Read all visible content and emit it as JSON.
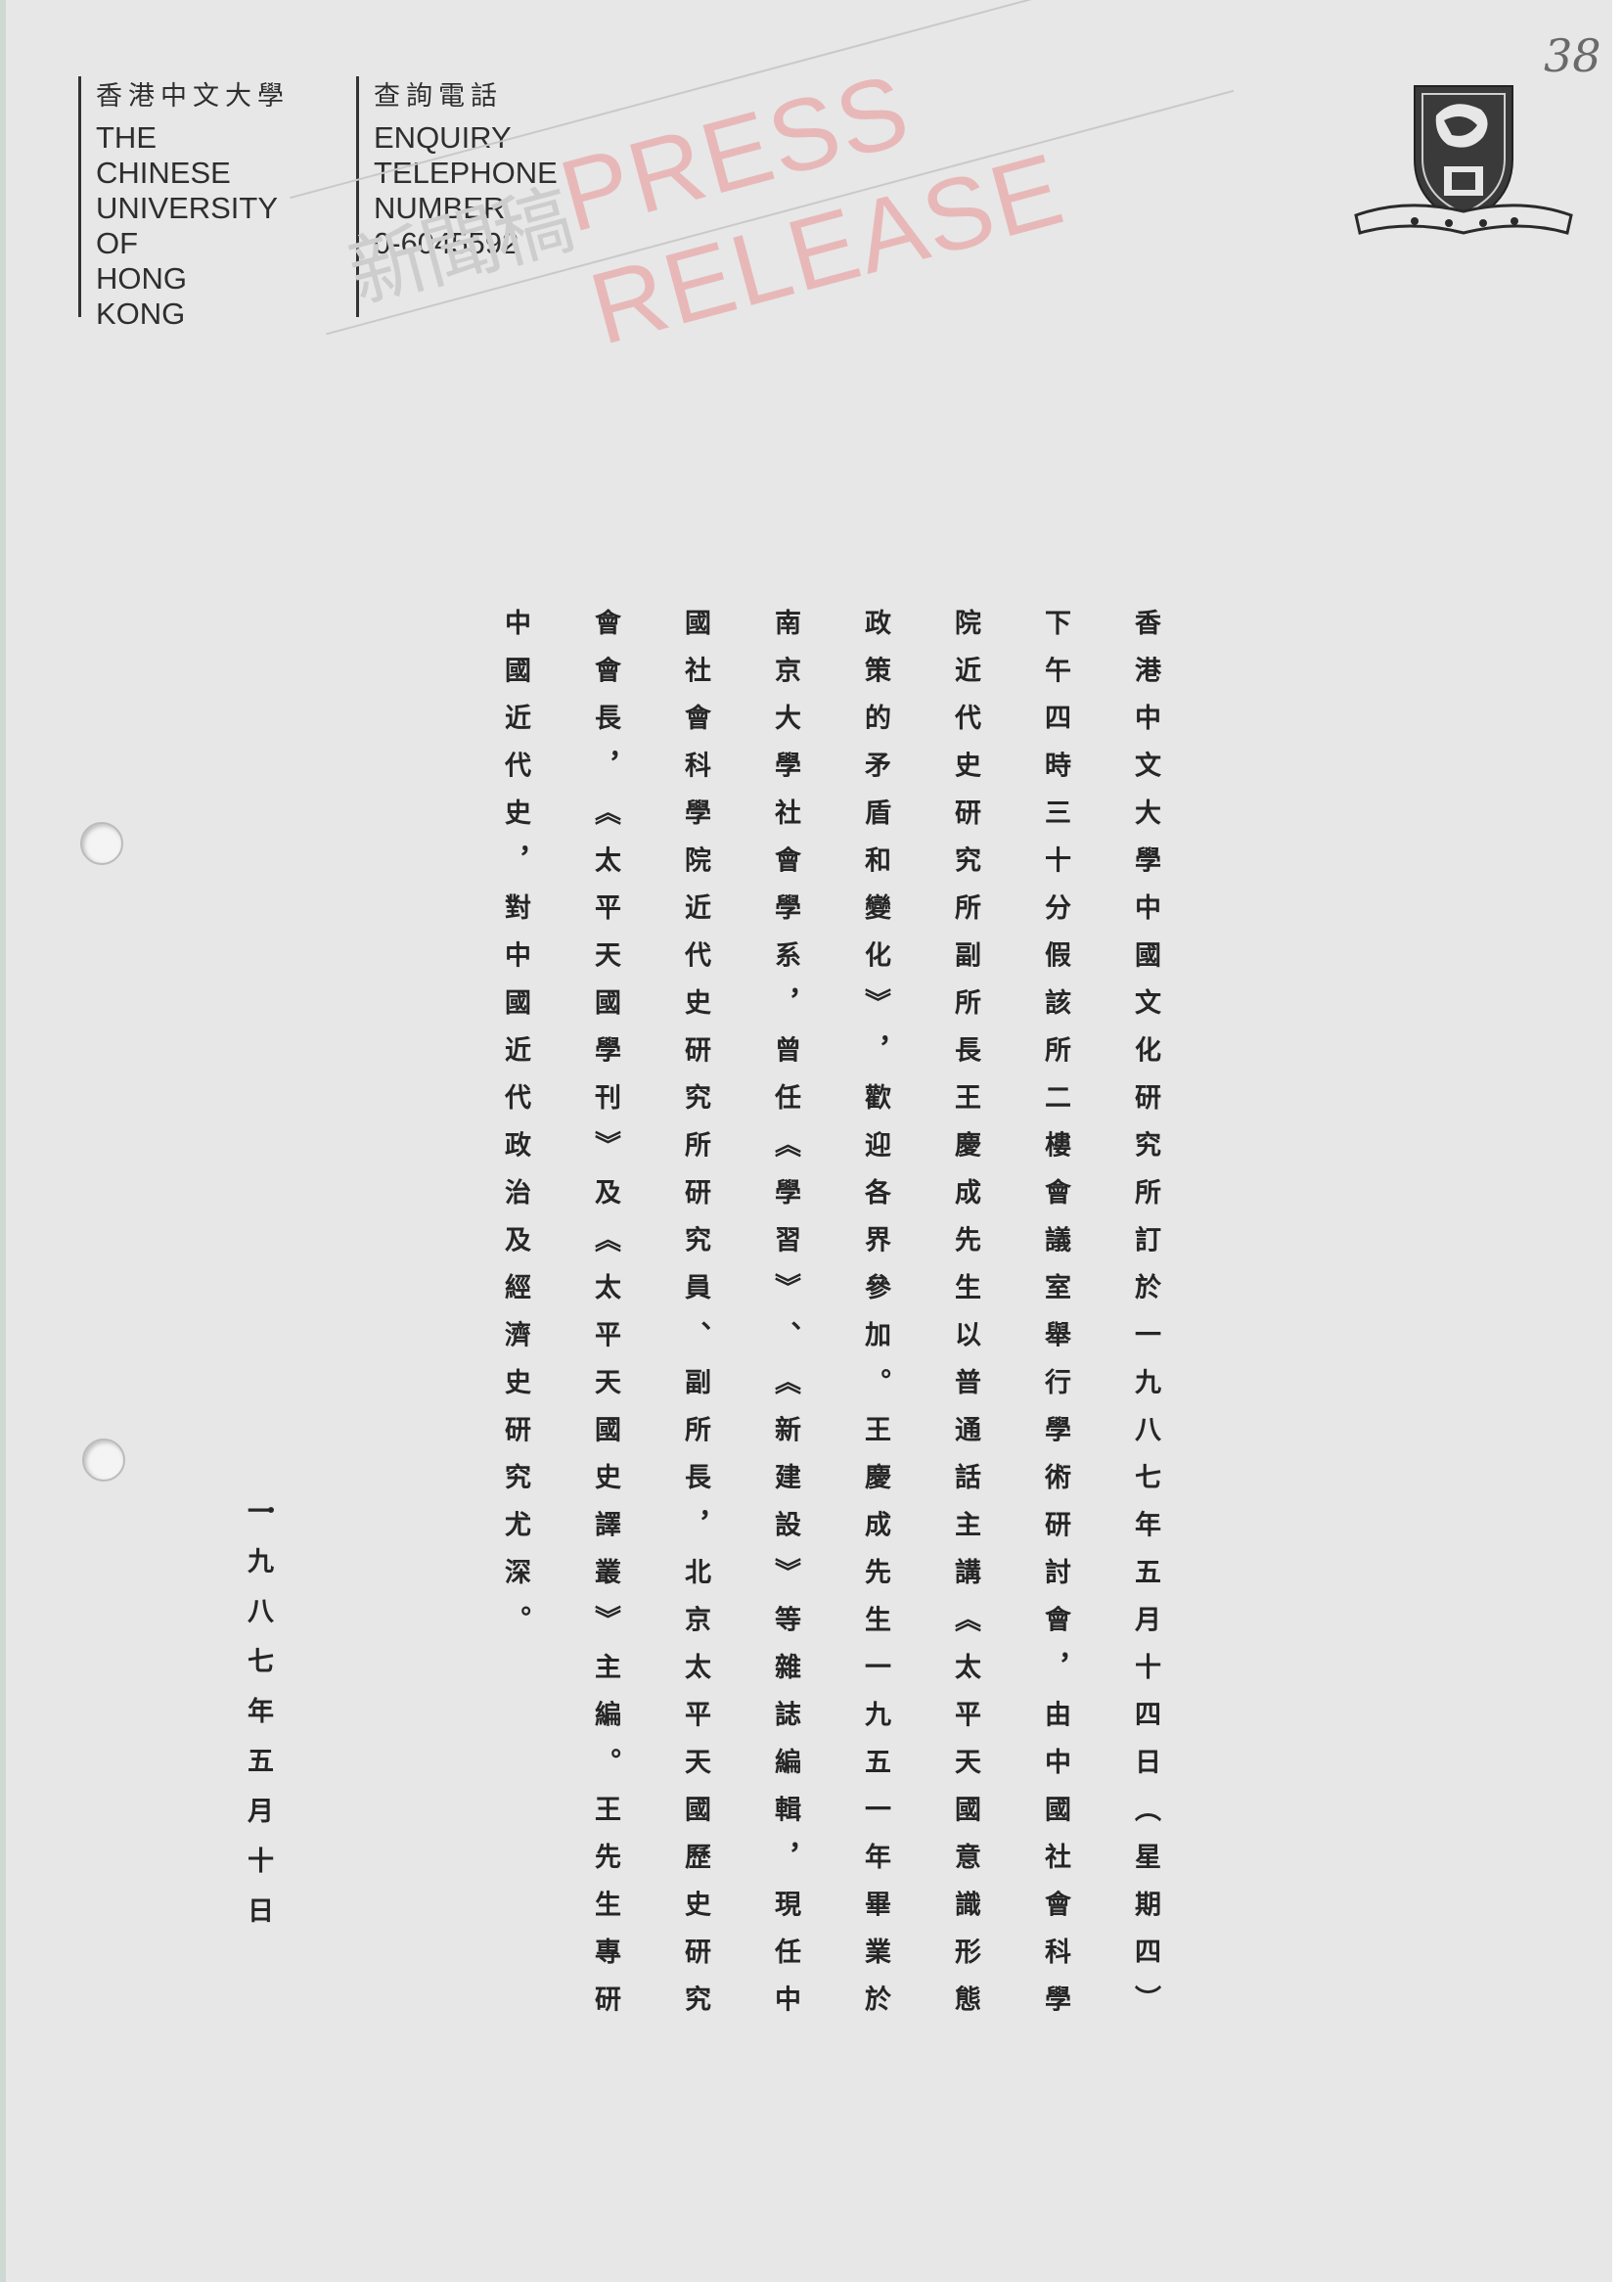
{
  "header": {
    "university": {
      "name_zh": "香港中文大學",
      "name_en_lines": [
        "THE",
        "CHINESE",
        "UNIVERSITY",
        "OF",
        "HONG",
        "KONG"
      ]
    },
    "enquiry": {
      "label_zh": "查詢電話",
      "label_en_lines": [
        "ENQUIRY",
        "TELEPHONE",
        "NUMBER"
      ],
      "number": "0-6045592"
    }
  },
  "page_number": "38",
  "stamp": {
    "text_zh": "新聞稿",
    "text_en": "PRESS RELEASE"
  },
  "emblem": {
    "icon": "university-crest-icon",
    "colors": {
      "ink": "#2a2a2a",
      "paper": "#e7e7e7"
    }
  },
  "body": {
    "text": "香港中文大學中國文化研究所訂於一九八七年五月十四日（星期四）下午四時三十分假該所二樓會議室舉行學術研討會，由中國社會科學院近代史研究所副所長王慶成先生以普通話主講︽太平天國意識形態政策的矛盾和變化︾，歡迎各界參加。王慶成先生一九五一年畢業於南京大學社會學系，曾任︽學習︾、︽新建設︾等雜誌編輯，現任中國社會科學院近代史研究所研究員、副所長，北京太平天國歷史研究會會長，︽太平天國學刊︾及︽太平天國史譯叢︾主編。王先生專研中國近代史，對中國近代政治及經濟史研究尤深。"
  },
  "date": "一九八七年五月十日"
}
